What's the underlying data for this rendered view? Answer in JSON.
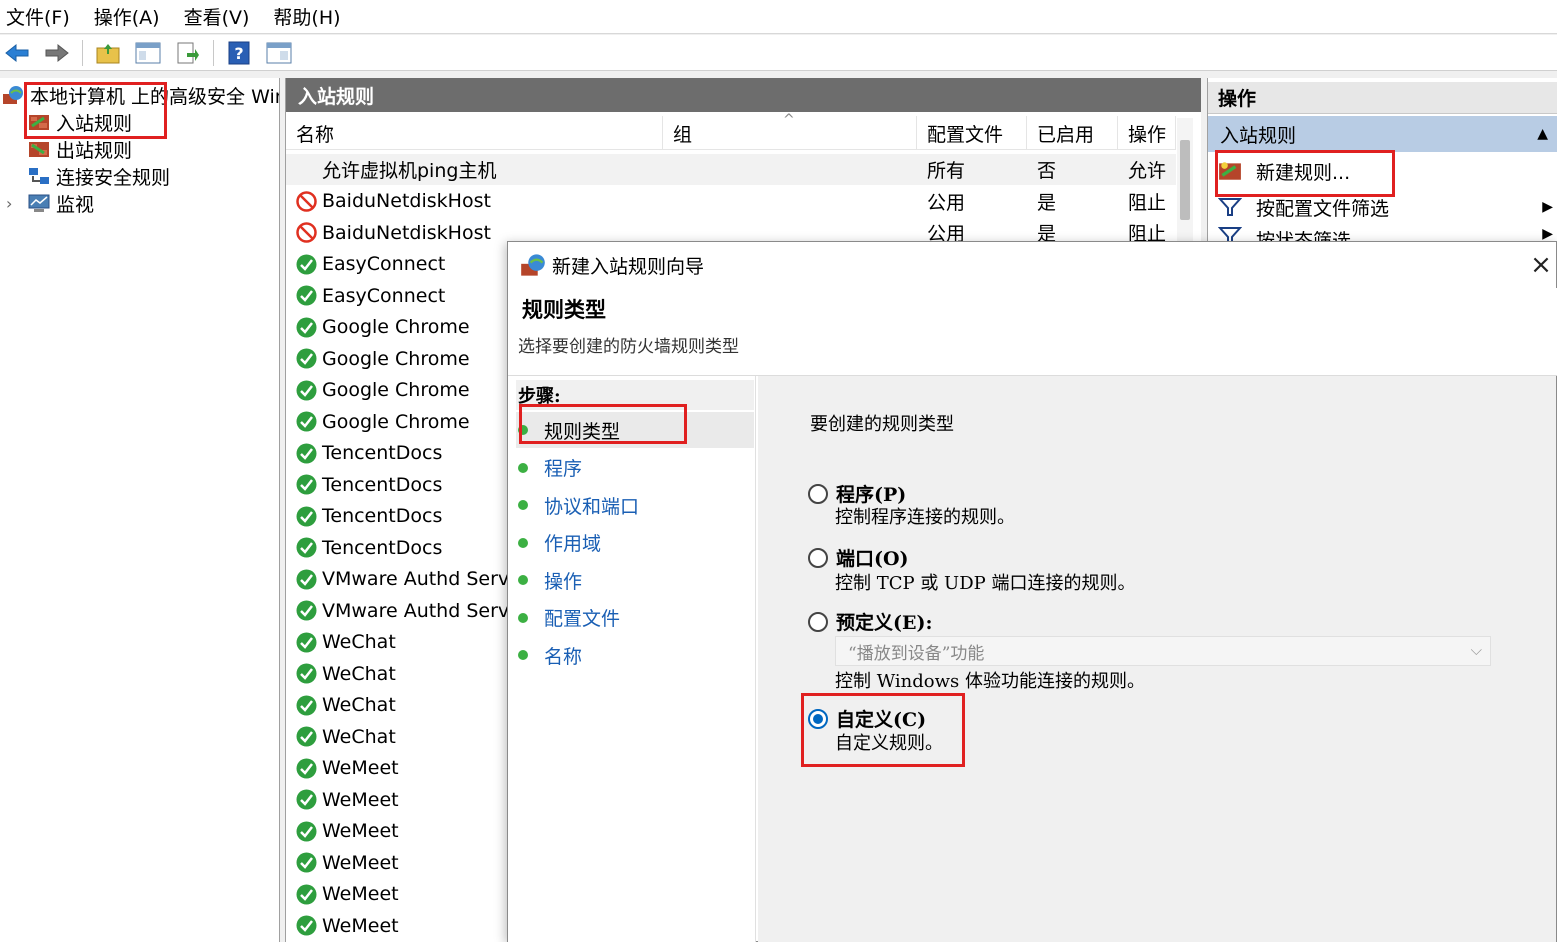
{
  "menu": [
    "文件(F)",
    "操作(A)",
    "查看(V)",
    "帮助(H)"
  ],
  "tree": {
    "root": "本地计算机 上的高级安全 Windows Defender 防火墙",
    "items": [
      "入站规则",
      "出站规则",
      "连接安全规则",
      "监视"
    ]
  },
  "middle": {
    "title": "入站规则",
    "columns": [
      "名称",
      "组",
      "配置文件",
      "已启用",
      "操作"
    ],
    "rows": [
      {
        "name": "允许虚拟机ping主机",
        "status": "none",
        "profile": "所有",
        "enabled": "否",
        "action": "允许"
      },
      {
        "name": "BaiduNetdiskHost",
        "status": "block",
        "profile": "公用",
        "enabled": "是",
        "action": "阻止"
      },
      {
        "name": "BaiduNetdiskHost",
        "status": "block",
        "profile": "公用",
        "enabled": "是",
        "action": "阻止"
      },
      {
        "name": "EasyConnect",
        "status": "allow"
      },
      {
        "name": "EasyConnect",
        "status": "allow"
      },
      {
        "name": "Google Chrome",
        "status": "allow"
      },
      {
        "name": "Google Chrome",
        "status": "allow"
      },
      {
        "name": "Google Chrome",
        "status": "allow"
      },
      {
        "name": "Google Chrome",
        "status": "allow"
      },
      {
        "name": "TencentDocs",
        "status": "allow"
      },
      {
        "name": "TencentDocs",
        "status": "allow"
      },
      {
        "name": "TencentDocs",
        "status": "allow"
      },
      {
        "name": "TencentDocs",
        "status": "allow"
      },
      {
        "name": "VMware Authd Service",
        "status": "allow"
      },
      {
        "name": "VMware Authd Service",
        "status": "allow"
      },
      {
        "name": "WeChat",
        "status": "allow"
      },
      {
        "name": "WeChat",
        "status": "allow"
      },
      {
        "name": "WeChat",
        "status": "allow"
      },
      {
        "name": "WeChat",
        "status": "allow"
      },
      {
        "name": "WeMeet",
        "status": "allow"
      },
      {
        "name": "WeMeet",
        "status": "allow"
      },
      {
        "name": "WeMeet",
        "status": "allow"
      },
      {
        "name": "WeMeet",
        "status": "allow"
      },
      {
        "name": "WeMeet",
        "status": "allow"
      },
      {
        "name": "WeMeet",
        "status": "allow"
      }
    ]
  },
  "actions": {
    "title": "操作",
    "section": "入站规则",
    "items": [
      "新建规则...",
      "按配置文件筛选",
      "按状态筛选"
    ]
  },
  "dialog": {
    "title": "新建入站规则向导",
    "heading": "规则类型",
    "subtitle": "选择要创建的防火墙规则类型",
    "steps_label": "步骤:",
    "steps": [
      "规则类型",
      "程序",
      "协议和端口",
      "作用域",
      "操作",
      "配置文件",
      "名称"
    ],
    "question": "要创建的规则类型",
    "options": [
      {
        "label": "程序(P)",
        "desc": "控制程序连接的规则。",
        "checked": false
      },
      {
        "label": "端口(O)",
        "desc": "控制 TCP 或 UDP 端口连接的规则。",
        "checked": false
      },
      {
        "label": "预定义(E):",
        "desc": "控制 Windows 体验功能连接的规则。",
        "checked": false
      },
      {
        "label": "自定义(C)",
        "desc": "自定义规则。",
        "checked": true
      }
    ],
    "predefined_value": "“播放到设备”功能"
  }
}
